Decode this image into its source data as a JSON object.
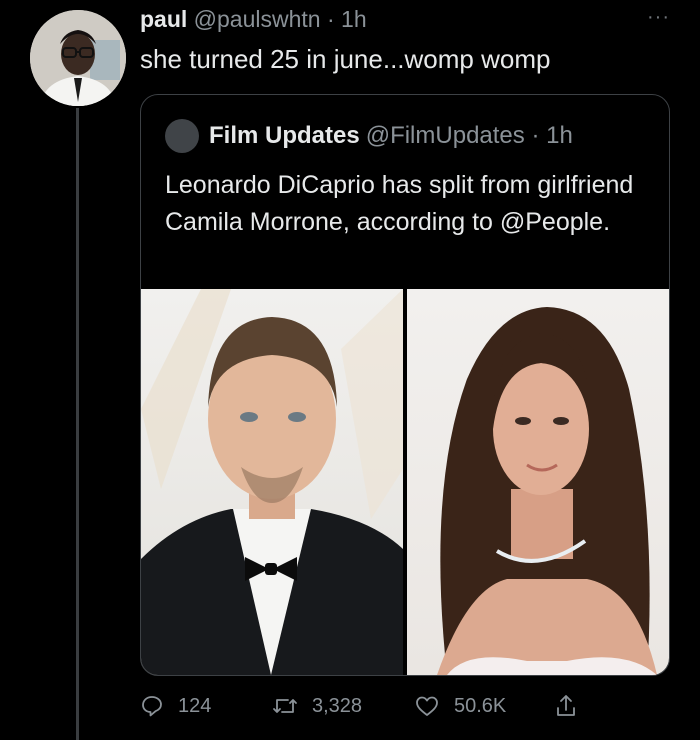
{
  "tweet": {
    "display_name": "paul",
    "handle": "@paulswhtn",
    "time": "· 1h",
    "more": "···",
    "text": "she turned 25 in june...womp womp"
  },
  "quoted": {
    "display_name": "Film Updates",
    "handle": "@FilmUpdates",
    "time": "· 1h",
    "text": "Leonardo DiCaprio has split from girlfriend Camila Morrone, according to @People."
  },
  "actions": {
    "replies": "124",
    "retweets": "3,328",
    "likes": "50.6K"
  },
  "colors": {
    "background": "#000000",
    "text": "#e7e9ea",
    "secondary": "#8b9298",
    "border": "#3d4145"
  }
}
